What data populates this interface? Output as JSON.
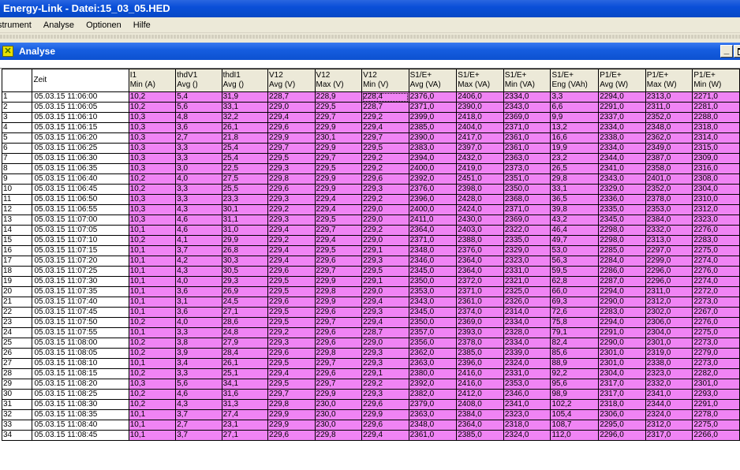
{
  "window": {
    "title": "Energy-Link - Datei:15_03_05.HED"
  },
  "menu": [
    "strument",
    "Analyse",
    "Optionen",
    "Hilfe"
  ],
  "child": {
    "title": "Analyse",
    "minimize": "_"
  },
  "columns": [
    {
      "line1": "I1",
      "line2": "Min (A)"
    },
    {
      "line1": "thdV1",
      "line2": "Avg ()"
    },
    {
      "line1": "thdI1",
      "line2": "Avg ()"
    },
    {
      "line1": "V12",
      "line2": "Avg (V)"
    },
    {
      "line1": "V12",
      "line2": "Max (V)"
    },
    {
      "line1": "V12",
      "line2": "Min (V)"
    },
    {
      "line1": "S1/E+",
      "line2": "Avg (VA)"
    },
    {
      "line1": "S1/E+",
      "line2": "Max (VA)"
    },
    {
      "line1": "S1/E+",
      "line2": "Min (VA)"
    },
    {
      "line1": "S1/E+",
      "line2": "Eng (VAh)"
    },
    {
      "line1": "P1/E+",
      "line2": "Avg (W)"
    },
    {
      "line1": "P1/E+",
      "line2": "Max (W)"
    },
    {
      "line1": "P1/E+",
      "line2": "Min (W)"
    }
  ],
  "zeit_header": "Zeit",
  "rows": [
    [
      "1",
      "05.03.15  11:06:00",
      "10,2",
      "5,4",
      "31,9",
      "228,7",
      "228,9",
      "228,4",
      "2376,0",
      "2406,0",
      "2334,0",
      "3,3",
      "2294,0",
      "2313,0",
      "2271,0"
    ],
    [
      "2",
      "05.03.15  11:06:05",
      "10,2",
      "5,6",
      "33,1",
      "229,0",
      "229,5",
      "228,7",
      "2371,0",
      "2390,0",
      "2343,0",
      "6,6",
      "2291,0",
      "2311,0",
      "2281,0"
    ],
    [
      "3",
      "05.03.15  11:06:10",
      "10,3",
      "4,8",
      "32,2",
      "229,4",
      "229,7",
      "229,2",
      "2399,0",
      "2418,0",
      "2369,0",
      "9,9",
      "2337,0",
      "2352,0",
      "2288,0"
    ],
    [
      "4",
      "05.03.15  11:06:15",
      "10,3",
      "3,6",
      "26,1",
      "229,6",
      "229,9",
      "229,4",
      "2385,0",
      "2404,0",
      "2371,0",
      "13,2",
      "2334,0",
      "2348,0",
      "2318,0"
    ],
    [
      "5",
      "05.03.15  11:06:20",
      "10,3",
      "2,7",
      "21,8",
      "229,9",
      "230,1",
      "229,7",
      "2390,0",
      "2417,0",
      "2361,0",
      "16,6",
      "2338,0",
      "2362,0",
      "2314,0"
    ],
    [
      "6",
      "05.03.15  11:06:25",
      "10,3",
      "3,3",
      "25,4",
      "229,7",
      "229,9",
      "229,5",
      "2383,0",
      "2397,0",
      "2361,0",
      "19,9",
      "2334,0",
      "2349,0",
      "2315,0"
    ],
    [
      "7",
      "05.03.15  11:06:30",
      "10,3",
      "3,3",
      "25,4",
      "229,5",
      "229,7",
      "229,2",
      "2394,0",
      "2432,0",
      "2363,0",
      "23,2",
      "2344,0",
      "2387,0",
      "2309,0"
    ],
    [
      "8",
      "05.03.15  11:06:35",
      "10,3",
      "3,0",
      "22,5",
      "229,3",
      "229,5",
      "229,2",
      "2400,0",
      "2419,0",
      "2373,0",
      "26,5",
      "2341,0",
      "2358,0",
      "2316,0"
    ],
    [
      "9",
      "05.03.15  11:06:40",
      "10,2",
      "4,0",
      "27,5",
      "229,8",
      "229,9",
      "229,6",
      "2392,0",
      "2451,0",
      "2351,0",
      "29,8",
      "2343,0",
      "2401,0",
      "2308,0"
    ],
    [
      "10",
      "05.03.15  11:06:45",
      "10,2",
      "3,3",
      "25,5",
      "229,6",
      "229,9",
      "229,3",
      "2376,0",
      "2398,0",
      "2350,0",
      "33,1",
      "2329,0",
      "2352,0",
      "2304,0"
    ],
    [
      "11",
      "05.03.15  11:06:50",
      "10,3",
      "3,3",
      "23,3",
      "229,3",
      "229,4",
      "229,2",
      "2396,0",
      "2428,0",
      "2368,0",
      "36,5",
      "2336,0",
      "2378,0",
      "2310,0"
    ],
    [
      "12",
      "05.03.15  11:06:55",
      "10,3",
      "4,3",
      "30,1",
      "229,2",
      "229,4",
      "229,0",
      "2400,0",
      "2424,0",
      "2371,0",
      "39,8",
      "2335,0",
      "2353,0",
      "2312,0"
    ],
    [
      "13",
      "05.03.15  11:07:00",
      "10,3",
      "4,6",
      "31,1",
      "229,3",
      "229,5",
      "229,0",
      "2411,0",
      "2430,0",
      "2369,0",
      "43,2",
      "2345,0",
      "2384,0",
      "2323,0"
    ],
    [
      "14",
      "05.03.15  11:07:05",
      "10,1",
      "4,6",
      "31,0",
      "229,4",
      "229,7",
      "229,2",
      "2364,0",
      "2403,0",
      "2322,0",
      "46,4",
      "2298,0",
      "2332,0",
      "2276,0"
    ],
    [
      "15",
      "05.03.15  11:07:10",
      "10,2",
      "4,1",
      "29,9",
      "229,2",
      "229,4",
      "229,0",
      "2371,0",
      "2388,0",
      "2335,0",
      "49,7",
      "2298,0",
      "2313,0",
      "2283,0"
    ],
    [
      "16",
      "05.03.15  11:07:15",
      "10,1",
      "3,7",
      "26,8",
      "229,4",
      "229,5",
      "229,1",
      "2348,0",
      "2376,0",
      "2329,0",
      "53,0",
      "2285,0",
      "2297,0",
      "2275,0"
    ],
    [
      "17",
      "05.03.15  11:07:20",
      "10,1",
      "4,2",
      "30,3",
      "229,4",
      "229,6",
      "229,3",
      "2346,0",
      "2364,0",
      "2323,0",
      "56,3",
      "2284,0",
      "2299,0",
      "2274,0"
    ],
    [
      "18",
      "05.03.15  11:07:25",
      "10,1",
      "4,3",
      "30,5",
      "229,6",
      "229,7",
      "229,5",
      "2345,0",
      "2364,0",
      "2331,0",
      "59,5",
      "2286,0",
      "2296,0",
      "2276,0"
    ],
    [
      "19",
      "05.03.15  11:07:30",
      "10,1",
      "4,0",
      "29,3",
      "229,5",
      "229,9",
      "229,1",
      "2350,0",
      "2372,0",
      "2321,0",
      "62,8",
      "2287,0",
      "2296,0",
      "2274,0"
    ],
    [
      "20",
      "05.03.15  11:07:35",
      "10,1",
      "3,6",
      "26,9",
      "229,5",
      "229,8",
      "229,0",
      "2353,0",
      "2371,0",
      "2325,0",
      "66,0",
      "2294,0",
      "2311,0",
      "2272,0"
    ],
    [
      "21",
      "05.03.15  11:07:40",
      "10,1",
      "3,1",
      "24,5",
      "229,6",
      "229,9",
      "229,4",
      "2343,0",
      "2361,0",
      "2326,0",
      "69,3",
      "2290,0",
      "2312,0",
      "2273,0"
    ],
    [
      "22",
      "05.03.15  11:07:45",
      "10,1",
      "3,6",
      "27,1",
      "229,5",
      "229,6",
      "229,3",
      "2345,0",
      "2374,0",
      "2314,0",
      "72,6",
      "2283,0",
      "2302,0",
      "2267,0"
    ],
    [
      "23",
      "05.03.15  11:07:50",
      "10,2",
      "4,0",
      "28,6",
      "229,5",
      "229,7",
      "229,4",
      "2350,0",
      "2369,0",
      "2334,0",
      "75,8",
      "2294,0",
      "2306,0",
      "2276,0"
    ],
    [
      "24",
      "05.03.15  11:07:55",
      "10,1",
      "3,3",
      "24,8",
      "229,2",
      "229,6",
      "228,7",
      "2357,0",
      "2393,0",
      "2328,0",
      "79,1",
      "2291,0",
      "2304,0",
      "2275,0"
    ],
    [
      "25",
      "05.03.15  11:08:00",
      "10,2",
      "3,8",
      "27,9",
      "229,3",
      "229,6",
      "229,0",
      "2356,0",
      "2378,0",
      "2334,0",
      "82,4",
      "2290,0",
      "2301,0",
      "2273,0"
    ],
    [
      "26",
      "05.03.15  11:08:05",
      "10,2",
      "3,9",
      "28,4",
      "229,6",
      "229,8",
      "229,3",
      "2362,0",
      "2385,0",
      "2339,0",
      "85,6",
      "2301,0",
      "2319,0",
      "2279,0"
    ],
    [
      "27",
      "05.03.15  11:08:10",
      "10,1",
      "3,4",
      "26,1",
      "229,5",
      "229,7",
      "229,3",
      "2363,0",
      "2396,0",
      "2324,0",
      "88,9",
      "2301,0",
      "2338,0",
      "2273,0"
    ],
    [
      "28",
      "05.03.15  11:08:15",
      "10,2",
      "3,3",
      "25,1",
      "229,4",
      "229,6",
      "229,1",
      "2380,0",
      "2416,0",
      "2331,0",
      "92,2",
      "2304,0",
      "2323,0",
      "2282,0"
    ],
    [
      "29",
      "05.03.15  11:08:20",
      "10,3",
      "5,6",
      "34,1",
      "229,5",
      "229,7",
      "229,2",
      "2392,0",
      "2416,0",
      "2353,0",
      "95,6",
      "2317,0",
      "2332,0",
      "2301,0"
    ],
    [
      "30",
      "05.03.15  11:08:25",
      "10,2",
      "4,6",
      "31,6",
      "229,7",
      "229,9",
      "229,3",
      "2382,0",
      "2412,0",
      "2346,0",
      "98,9",
      "2317,0",
      "2341,0",
      "2293,0"
    ],
    [
      "31",
      "05.03.15  11:08:30",
      "10,2",
      "4,3",
      "31,3",
      "229,8",
      "230,0",
      "229,6",
      "2379,0",
      "2408,0",
      "2341,0",
      "102,2",
      "2318,0",
      "2344,0",
      "2291,0"
    ],
    [
      "32",
      "05.03.15  11:08:35",
      "10,1",
      "3,7",
      "27,4",
      "229,9",
      "230,0",
      "229,9",
      "2363,0",
      "2384,0",
      "2323,0",
      "105,4",
      "2306,0",
      "2324,0",
      "2278,0"
    ],
    [
      "33",
      "05.03.15  11:08:40",
      "10,1",
      "2,7",
      "23,1",
      "229,9",
      "230,0",
      "229,6",
      "2348,0",
      "2364,0",
      "2318,0",
      "108,7",
      "2295,0",
      "2312,0",
      "2275,0"
    ],
    [
      "34",
      "05.03.15  11:08:45",
      "10,1",
      "3,7",
      "27,1",
      "229,6",
      "229,8",
      "229,4",
      "2361,0",
      "2385,0",
      "2324,0",
      "112,0",
      "2296,0",
      "2317,0",
      "2266,0"
    ]
  ],
  "colors": {
    "value_cell": "#f084f4",
    "title_bar": "#0a4fd8"
  }
}
